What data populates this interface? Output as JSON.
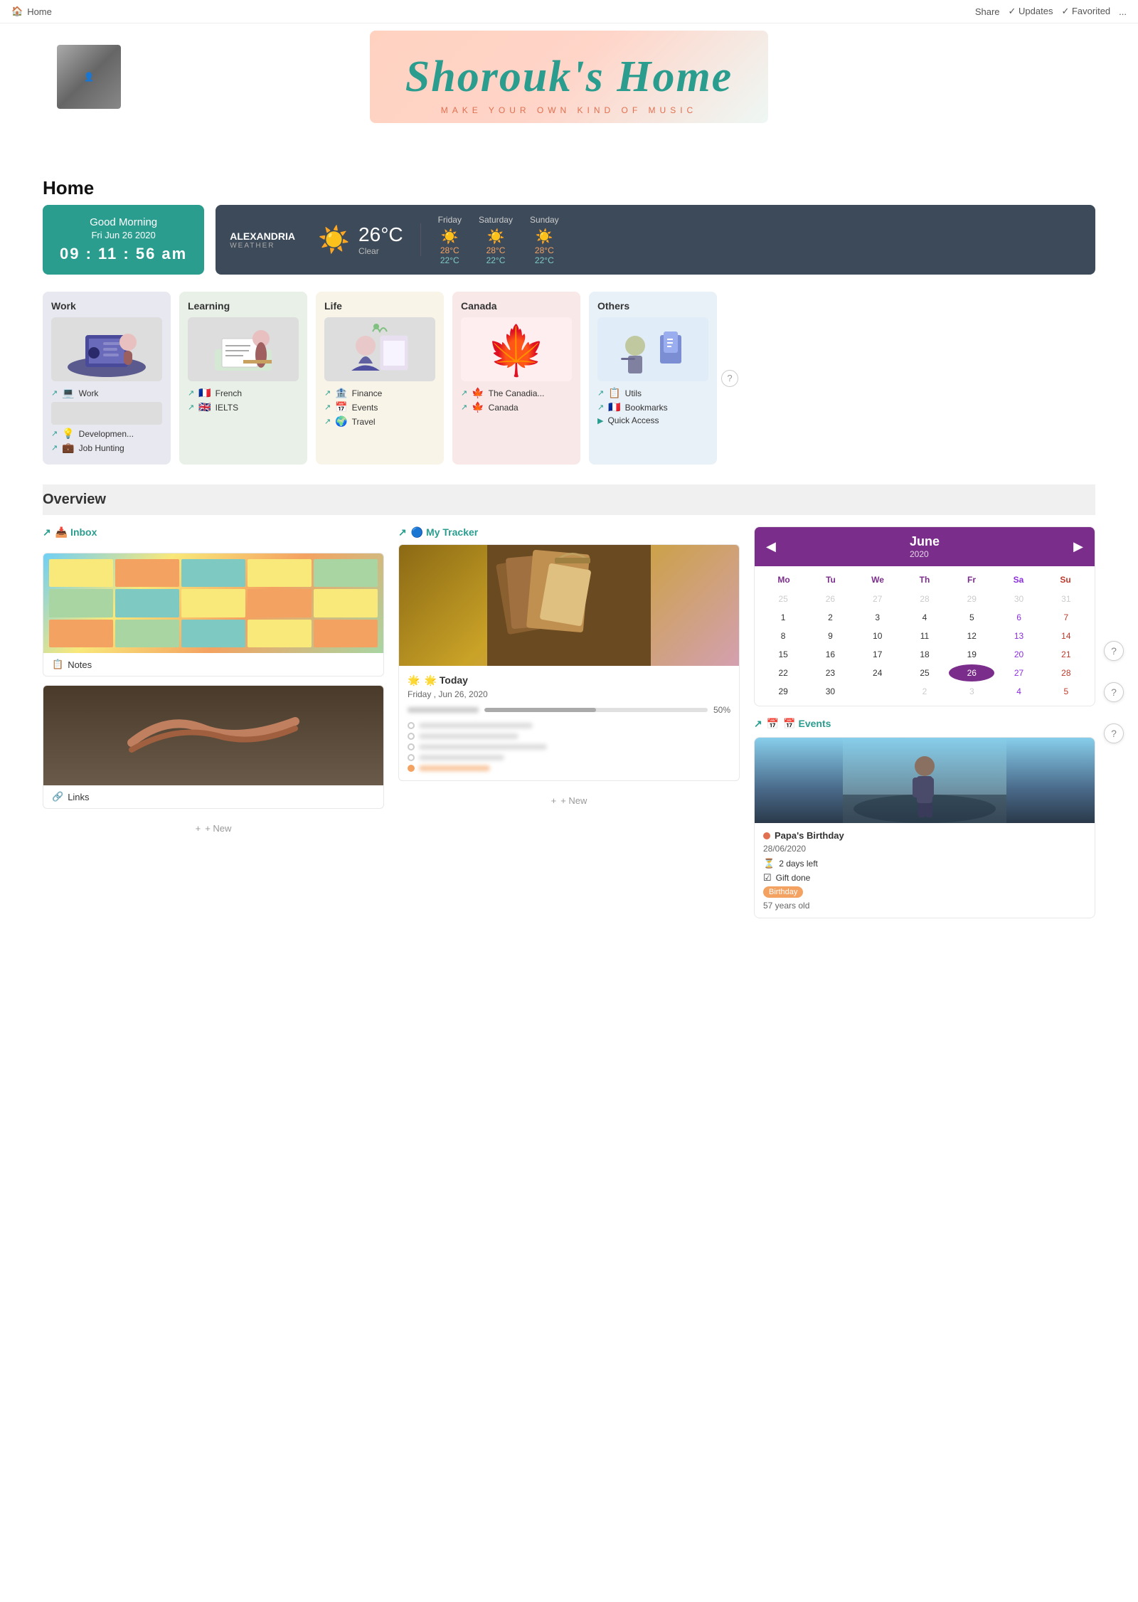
{
  "topbar": {
    "home_label": "Home",
    "share_label": "Share",
    "updates_label": "✓ Updates",
    "favorited_label": "✓ Favorited",
    "more_label": "..."
  },
  "hero": {
    "title": "Shorouk's Home",
    "subtitle": "MAKE YOUR OWN KIND OF MUSIC"
  },
  "page_title": "Home",
  "clock": {
    "greeting": "Good Morning",
    "date": "Fri Jun 26 2020",
    "time": "09 : 11 : 56 am"
  },
  "weather": {
    "location": "ALEXANDRIA",
    "location_label": "WEATHER",
    "temp": "26°C",
    "desc": "Clear",
    "forecast": [
      {
        "day": "Friday",
        "hi": "28°C",
        "lo": "22°C"
      },
      {
        "day": "Saturday",
        "hi": "28°C",
        "lo": "22°C"
      },
      {
        "day": "Sunday",
        "hi": "28°C",
        "lo": "22°C"
      }
    ]
  },
  "categories": [
    {
      "id": "work",
      "title": "Work",
      "links": [
        {
          "label": "Work",
          "icon": "💻"
        },
        {
          "label": "Developmen...",
          "icon": "💡"
        },
        {
          "label": "Job Hunting",
          "icon": "💼"
        }
      ]
    },
    {
      "id": "learning",
      "title": "Learning",
      "links": [
        {
          "label": "French",
          "icon": "🇫🇷"
        },
        {
          "label": "IELTS",
          "icon": "🇬🇧"
        }
      ]
    },
    {
      "id": "life",
      "title": "Life",
      "links": [
        {
          "label": "Finance",
          "icon": "🏦"
        },
        {
          "label": "Events",
          "icon": "📅"
        },
        {
          "label": "Travel",
          "icon": "🌍"
        }
      ]
    },
    {
      "id": "canada",
      "title": "Canada",
      "links": [
        {
          "label": "The Canadia...",
          "icon": "🍁"
        },
        {
          "label": "Canada",
          "icon": "🍁"
        }
      ]
    },
    {
      "id": "others",
      "title": "Others",
      "links": [
        {
          "label": "Utils",
          "icon": "📋"
        },
        {
          "label": "Bookmarks",
          "icon": "🇫🇷"
        },
        {
          "label": "Quick Access",
          "icon": "▶"
        }
      ]
    }
  ],
  "overview": {
    "title": "Overview",
    "inbox": {
      "header": "📥 Inbox",
      "items": [
        {
          "label": "📋 Notes",
          "type": "notes"
        },
        {
          "label": "🔗 Links",
          "type": "links"
        }
      ],
      "new_label": "+ New"
    },
    "tracker": {
      "header": "🔵 My Tracker",
      "today_label": "🌟 Today",
      "date": "Friday , Jun 26, 2020",
      "progress": "50%",
      "new_label": "+ New"
    },
    "calendar": {
      "month": "June",
      "year": "2020",
      "days_header": [
        "Mo",
        "Tu",
        "We",
        "Th",
        "Fr",
        "Sa",
        "Su"
      ],
      "prev": "◀",
      "next": "▶",
      "weeks": [
        [
          "25",
          "26",
          "27",
          "28",
          "29",
          "30",
          "31"
        ],
        [
          "1",
          "2",
          "3",
          "4",
          "5",
          "6",
          "7"
        ],
        [
          "8",
          "9",
          "10",
          "11",
          "12",
          "13",
          "14"
        ],
        [
          "15",
          "16",
          "17",
          "18",
          "19",
          "20",
          "21"
        ],
        [
          "22",
          "23",
          "24",
          "25",
          "26",
          "27",
          "28"
        ],
        [
          "29",
          "30",
          "",
          "2",
          "3",
          "4",
          "5"
        ]
      ],
      "today_date": "26",
      "weekends_sat": [
        "6",
        "13",
        "20",
        "27"
      ],
      "weekends_sun": [
        "7",
        "14",
        "21",
        "28"
      ]
    },
    "events": {
      "header": "📅 Events",
      "event": {
        "title": "Papa's Birthday",
        "date": "28/06/2020",
        "days_left": "⏳ 2 days left",
        "gift": "☑ Gift done",
        "tag": "Birthday",
        "age": "57 years old"
      }
    }
  },
  "help_buttons": [
    "?",
    "?",
    "?"
  ]
}
